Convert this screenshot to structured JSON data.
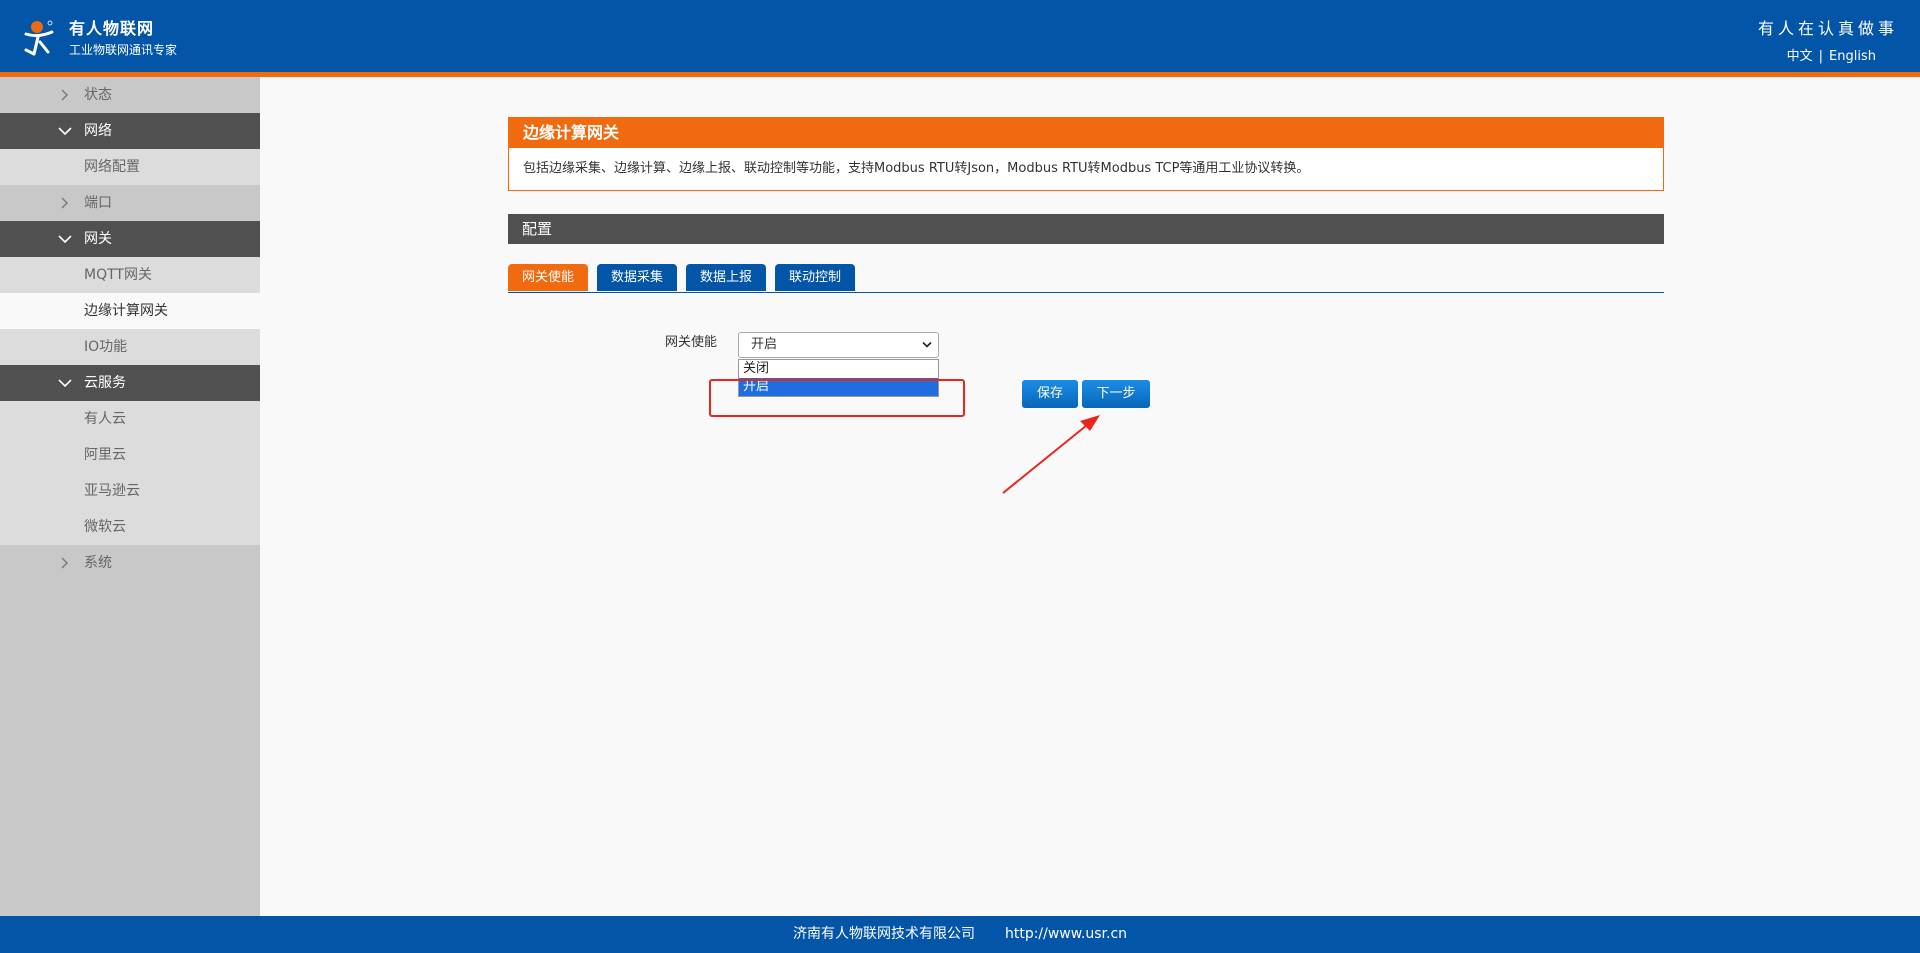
{
  "header": {
    "brand_name": "有人物联网",
    "brand_sub": "工业物联网通讯专家",
    "slogan": "有人在认真做事",
    "lang_cn": "中文",
    "lang_sep": "|",
    "lang_en": "English"
  },
  "sidebar": {
    "items": [
      {
        "label": "状态",
        "type": "group-collapsed"
      },
      {
        "label": "网络",
        "type": "group-open"
      },
      {
        "label": "网络配置",
        "type": "sub"
      },
      {
        "label": "端口",
        "type": "group-collapsed"
      },
      {
        "label": "网关",
        "type": "group-open"
      },
      {
        "label": "MQTT网关",
        "type": "sub"
      },
      {
        "label": "边缘计算网关",
        "type": "sub-active"
      },
      {
        "label": "IO功能",
        "type": "sub"
      },
      {
        "label": "云服务",
        "type": "group-open"
      },
      {
        "label": "有人云",
        "type": "sub"
      },
      {
        "label": "阿里云",
        "type": "sub"
      },
      {
        "label": "亚马逊云",
        "type": "sub"
      },
      {
        "label": "微软云",
        "type": "sub"
      },
      {
        "label": "系统",
        "type": "group-collapsed"
      }
    ]
  },
  "main": {
    "intro_title": "边缘计算网关",
    "intro_desc": "包括边缘采集、边缘计算、边缘上报、联动控制等功能，支持Modbus RTU转Json，Modbus RTU转Modbus TCP等通用工业协议转换。",
    "config_title": "配置",
    "tabs": [
      {
        "label": "网关使能",
        "active": true
      },
      {
        "label": "数据采集",
        "active": false
      },
      {
        "label": "数据上报",
        "active": false
      },
      {
        "label": "联动控制",
        "active": false
      }
    ],
    "form": {
      "label": "网关使能",
      "selected_value": "开启",
      "options": [
        "关闭",
        "开启"
      ],
      "highlighted_option": "开启"
    },
    "buttons": {
      "save_label": "保存",
      "next_label": "下一步"
    }
  },
  "footer": {
    "company": "济南有人物联网技术有限公司",
    "url": "http://www.usr.cn"
  },
  "colors": {
    "header_blue": "#0255a7",
    "accent_orange": "#f26a0f",
    "dark_gray": "#505050",
    "annotation_red": "#e8261d"
  }
}
